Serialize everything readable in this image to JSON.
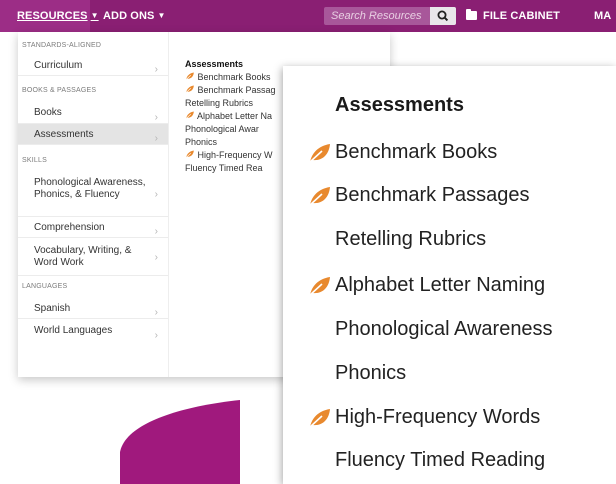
{
  "nav": {
    "resources": "RESOURCES",
    "addons": "ADD ONS",
    "search_placeholder": "Search Resources",
    "file_cabinet": "FILE CABINET",
    "more_cut": "MA"
  },
  "menu": {
    "sections": [
      {
        "heading": "STANDARDS-ALIGNED"
      },
      {
        "heading": "BOOKS & PASSAGES"
      },
      {
        "heading": "SKILLS"
      },
      {
        "heading": "LANGUAGES"
      }
    ],
    "items": [
      {
        "label": "Curriculum"
      },
      {
        "label": "Books"
      },
      {
        "label": "Assessments"
      },
      {
        "label": "Phonological Awareness, Phonics, & Fluency"
      },
      {
        "label": "Comprehension"
      },
      {
        "label": "Vocabulary, Writing, & Word Work"
      },
      {
        "label": "Spanish"
      },
      {
        "label": "World Languages"
      }
    ],
    "right_heading": "Assessments",
    "right_links": [
      {
        "label": "Benchmark Books",
        "icon": "leaf-icon"
      },
      {
        "label": "Benchmark Passag",
        "icon": "leaf-icon"
      },
      {
        "label": "Retelling Rubrics",
        "icon": null
      },
      {
        "label": "Alphabet Letter Na",
        "icon": "leaf-icon"
      },
      {
        "label": "Phonological Awar",
        "icon": null
      },
      {
        "label": "Phonics",
        "icon": null
      },
      {
        "label": "High-Frequency W",
        "icon": "leaf-icon"
      },
      {
        "label": "Fluency Timed Rea",
        "icon": null
      }
    ]
  },
  "zoom": {
    "heading": "Assessments",
    "items": [
      {
        "label": "Benchmark Books",
        "icon": "leaf-icon"
      },
      {
        "label": "Benchmark Passages",
        "icon": "leaf-icon"
      },
      {
        "label": "Retelling Rubrics",
        "icon": null
      },
      {
        "label": "Alphabet Letter Naming",
        "icon": "leaf-icon"
      },
      {
        "label": "Phonological Awareness",
        "icon": null
      },
      {
        "label": "Phonics",
        "icon": null
      },
      {
        "label": "High-Frequency Words",
        "icon": "leaf-icon"
      },
      {
        "label": "Fluency Timed Reading",
        "icon": null
      }
    ]
  },
  "colors": {
    "nav_bg": "#8a1f73",
    "leaf": "#e8892e",
    "arrow": "#a0197d"
  }
}
